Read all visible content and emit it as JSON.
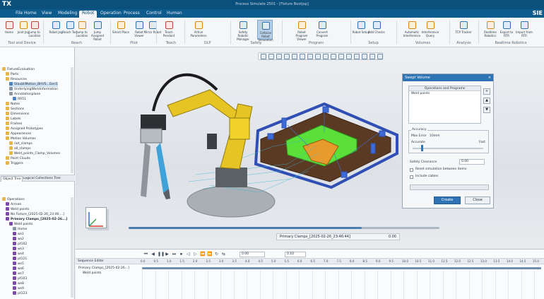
{
  "titlebar": {
    "logo": "TX",
    "title": "Process Simulate 2501 - [Fixture Bootjop]"
  },
  "menubar": {
    "tabs": [
      "File",
      "Home",
      "View",
      "Modeling",
      "Robot",
      "Operation",
      "Process",
      "Control",
      "Human"
    ],
    "active_tab": "Robot",
    "brand": "SIE"
  },
  "ribbon": {
    "buttons": [
      "Home",
      "Joint Jog",
      "Jump to Location",
      "Robot Jog",
      "Reach Test",
      "Jump to Location",
      "Jump Assigned Robot",
      "Smart Place",
      "Robot Viewer",
      "Mirror Robot",
      "Teach Pendant",
      "Active Parameters",
      "Safety Robotic Manager",
      "Collision Robot Simulation",
      "Robot Program Viewer",
      "Convert Program",
      "Robot Setup",
      "Add Checks",
      "Automatic Interference",
      "Interference Query",
      "TCP Tracker",
      "Realtime Robotics",
      "Export to RTR",
      "Import from RTR"
    ],
    "groups": [
      "Tool and Device",
      "Reach",
      "Pilot",
      "Teach",
      "OLP",
      "Safety",
      "Program",
      "Setup",
      "Volumes",
      "Analysis",
      "Realtime Robotics"
    ]
  },
  "object_tree": {
    "rows": [
      {
        "label": "FixtureEvaluation",
        "icon": "fold",
        "indent": 0
      },
      {
        "label": "Parts",
        "icon": "fold",
        "indent": 1
      },
      {
        "label": "Resources",
        "icon": "fold",
        "indent": 1
      },
      {
        "label": "StaubliMotion_BHVS...Gen5",
        "icon": "blue",
        "indent": 2,
        "highlight": true
      },
      {
        "label": "UnderlyingWorkInformation",
        "icon": "gry",
        "indent": 2
      },
      {
        "label": "Annotationplane",
        "icon": "gry",
        "indent": 2
      },
      {
        "label": "RR51",
        "icon": "blue",
        "indent": 3
      },
      {
        "label": "Notes",
        "icon": "fold",
        "indent": 1
      },
      {
        "label": "Sections",
        "icon": "fold",
        "indent": 1
      },
      {
        "label": "Dimensions",
        "icon": "fold",
        "indent": 1
      },
      {
        "label": "Labels",
        "icon": "fold",
        "indent": 1
      },
      {
        "label": "Frames",
        "icon": "fold",
        "indent": 1
      },
      {
        "label": "Assigned Prototypes",
        "icon": "fold",
        "indent": 1
      },
      {
        "label": "Appearances",
        "icon": "fold",
        "indent": 1
      },
      {
        "label": "Motion Volumes",
        "icon": "fold",
        "indent": 1
      },
      {
        "label": "not_clamps",
        "icon": "fold",
        "indent": 2
      },
      {
        "label": "all_clamps",
        "icon": "fold",
        "indent": 2
      },
      {
        "label": "Weld_points_Clamp_Volumes",
        "icon": "fold",
        "indent": 2
      },
      {
        "label": "Point Clouds",
        "icon": "fold",
        "indent": 1
      },
      {
        "label": "Triggers",
        "icon": "fold",
        "indent": 1
      }
    ],
    "tabs": [
      "Object Tree",
      "Logical Collections Tree"
    ]
  },
  "operation_tree": {
    "rows": [
      {
        "label": "Operations",
        "icon": "fold",
        "indent": 0
      },
      {
        "label": "Arcsee",
        "icon": "pur",
        "indent": 1
      },
      {
        "label": "Weld points",
        "icon": "pur",
        "indent": 1
      },
      {
        "label": "No Fixture_[2025-02-26_23:46:...]",
        "icon": "pur",
        "indent": 1
      },
      {
        "label": "Primary Clamps_[2025-02-26...]",
        "icon": "pur",
        "indent": 1,
        "bold": true
      },
      {
        "label": "Weld points",
        "icon": "pur",
        "indent": 2
      },
      {
        "label": "Home",
        "icon": "gry",
        "indent": 3
      },
      {
        "label": "ws1",
        "icon": "pur",
        "indent": 3
      },
      {
        "label": "ws2",
        "icon": "pur",
        "indent": 3
      },
      {
        "label": "pt102",
        "icon": "pur",
        "indent": 3
      },
      {
        "label": "ws3",
        "icon": "pur",
        "indent": 3
      },
      {
        "label": "ws4",
        "icon": "pur",
        "indent": 3
      },
      {
        "label": "pt121",
        "icon": "pur",
        "indent": 3
      },
      {
        "label": "ws5",
        "icon": "pur",
        "indent": 3
      },
      {
        "label": "ws6",
        "icon": "pur",
        "indent": 3
      },
      {
        "label": "ws7",
        "icon": "pur",
        "indent": 3
      },
      {
        "label": "pt103",
        "icon": "pur",
        "indent": 3
      },
      {
        "label": "ws8",
        "icon": "pur",
        "indent": 3
      },
      {
        "label": "ws9",
        "icon": "pur",
        "indent": 3
      },
      {
        "label": "pt123",
        "icon": "pur",
        "indent": 3
      }
    ]
  },
  "dialog": {
    "title": "Swept Volume",
    "close": "×",
    "list_header": "Operations and Programs",
    "list_item": "Weld points",
    "accuracy_title": "Accuracy",
    "max_error_label": "Max Error",
    "max_error_value": "10mm",
    "accurate_label": "Accurate",
    "fast_label": "Fast",
    "clearance_label": "Safety Clearance",
    "clearance_value": "0.00",
    "reset_label": "Reset simulation between items",
    "cables_label": "Include cables",
    "create_label": "Create",
    "close_label": "Close"
  },
  "viewport": {
    "op_label": "Primary Clamps_[2025-02-26_23:46:44]",
    "op_time": "0.00"
  },
  "sequence": {
    "title": "Sequence Editor",
    "time_start": "0.00",
    "time_end": "0.10",
    "ticks": [
      "0.0",
      "0.5",
      "1.0",
      "1.5",
      "2.0",
      "2.5",
      "3.0",
      "3.5",
      "4.0",
      "4.5",
      "5.0",
      "5.5",
      "6.0",
      "6.5",
      "7.0",
      "7.5",
      "8.0",
      "8.5",
      "9.0",
      "9.5",
      "10.0",
      "10.5",
      "11.0",
      "11.5",
      "12.0",
      "12.5",
      "13.0",
      "13.5",
      "14.0",
      "14.5",
      "15.0"
    ],
    "rows": [
      "Primary Clamps_[2025-02-26...]",
      "Weld points"
    ]
  }
}
